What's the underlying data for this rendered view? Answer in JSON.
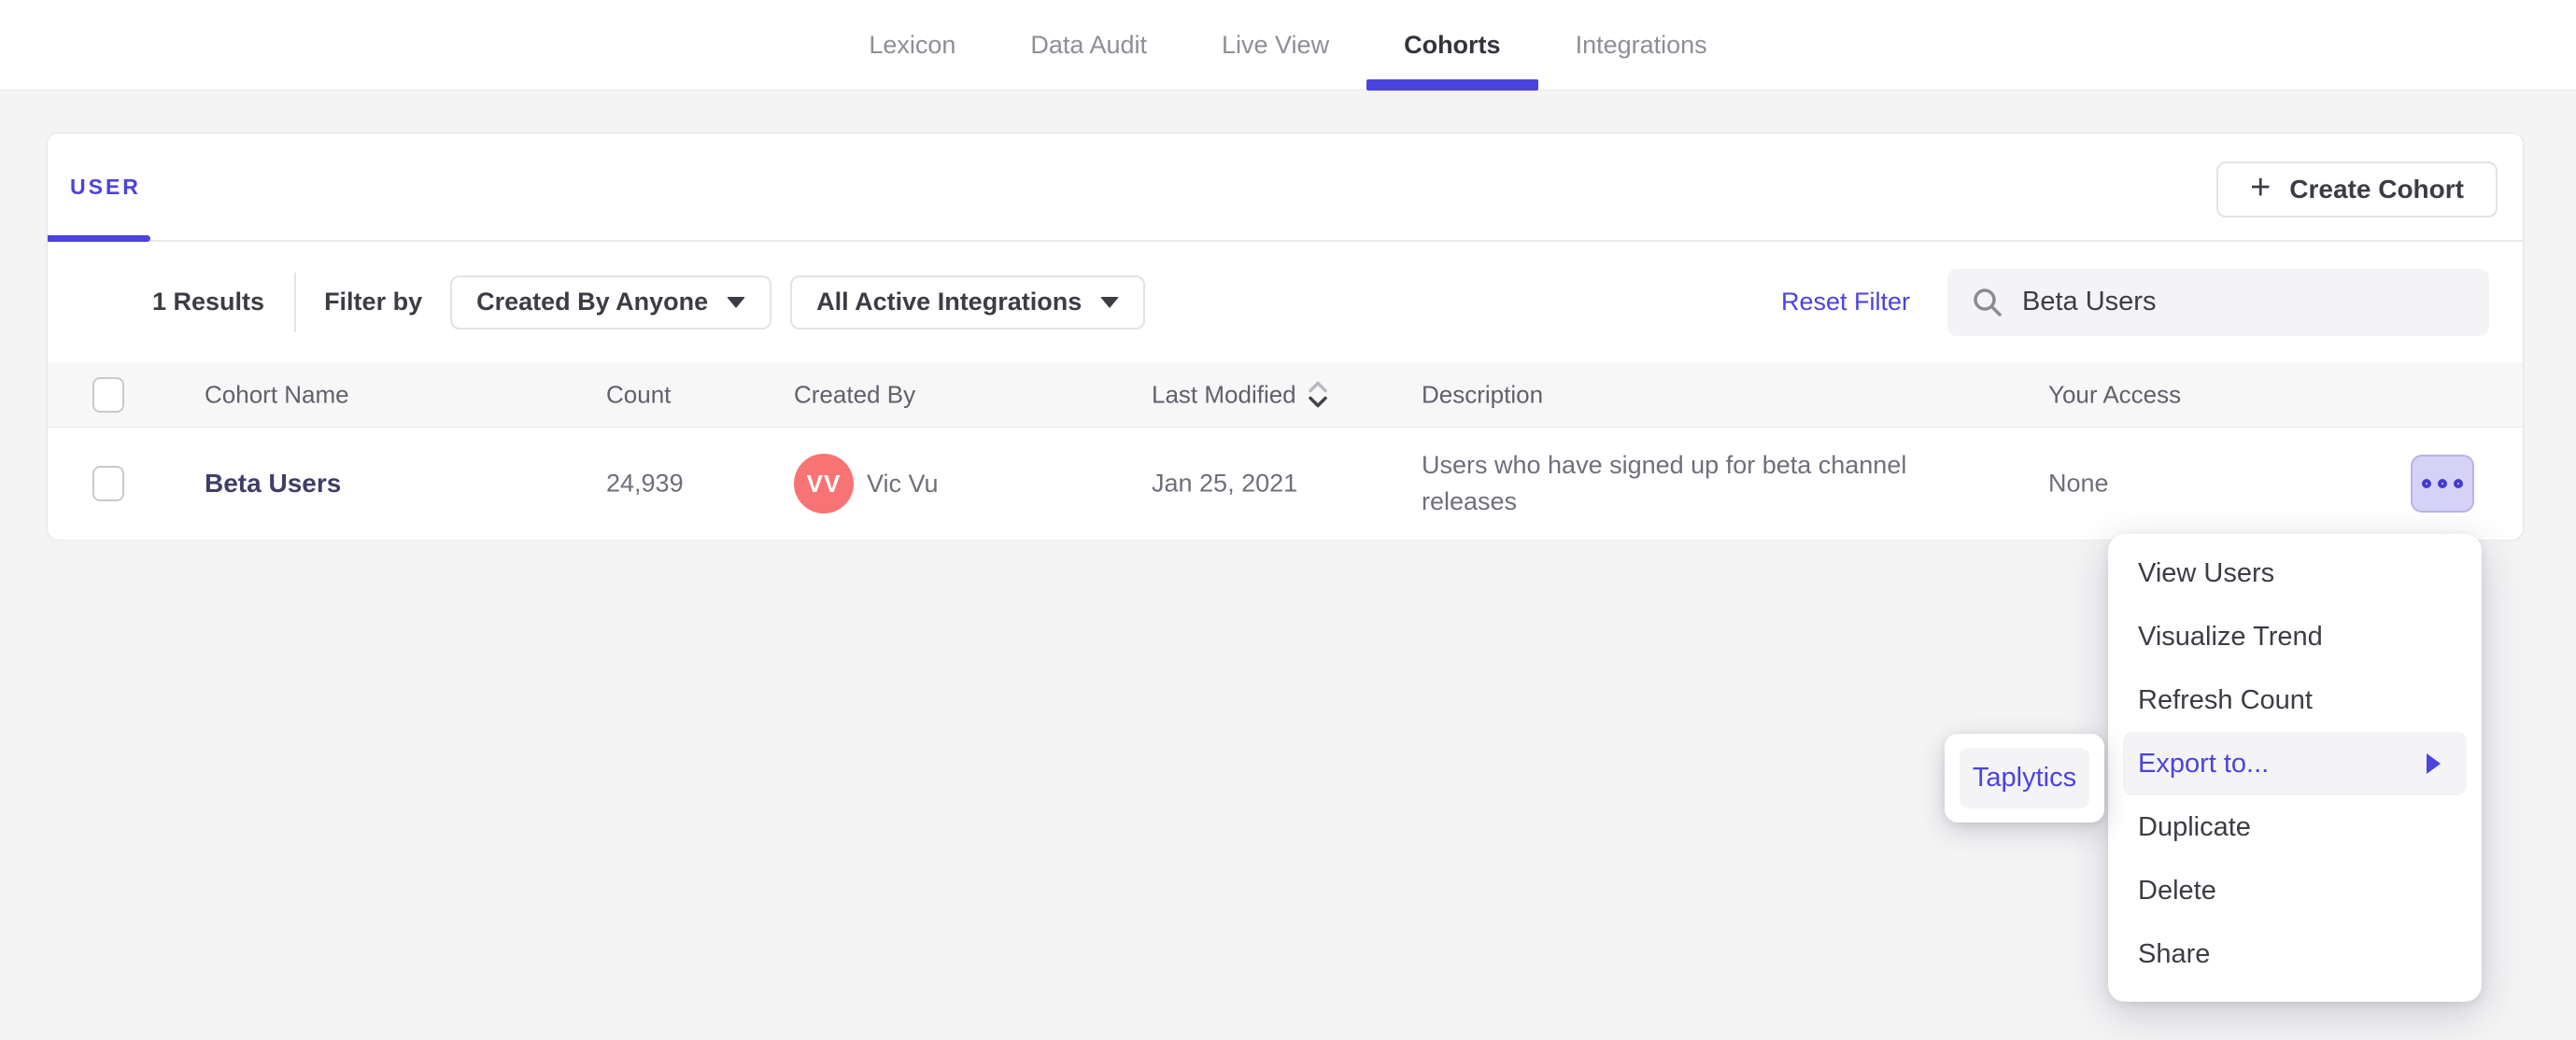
{
  "accent_color": "#4c42e0",
  "nav": {
    "tabs": [
      {
        "label": "Lexicon",
        "active": false
      },
      {
        "label": "Data Audit",
        "active": false
      },
      {
        "label": "Live View",
        "active": false
      },
      {
        "label": "Cohorts",
        "active": true
      },
      {
        "label": "Integrations",
        "active": false
      }
    ]
  },
  "cohorts_card": {
    "tab_label": "USER",
    "create_button_label": "Create Cohort",
    "create_button_plus": "+",
    "filter_bar": {
      "results_count": "1 Results",
      "filter_by_label": "Filter by",
      "dropdowns": [
        {
          "label": "Created By Anyone"
        },
        {
          "label": "All Active Integrations"
        }
      ],
      "reset_label": "Reset Filter",
      "search": {
        "value": "Beta Users",
        "icon": "search-icon"
      }
    },
    "table": {
      "columns": {
        "name": "Cohort Name",
        "count": "Count",
        "created_by": "Created By",
        "last_modified": "Last Modified",
        "description": "Description",
        "your_access": "Your Access"
      },
      "sort": {
        "column": "Last Modified",
        "direction": "desc"
      },
      "rows": [
        {
          "name": "Beta Users",
          "count": "24,939",
          "created_by": {
            "initials": "VV",
            "name": "Vic Vu",
            "avatar_color": "#f87373"
          },
          "last_modified": "Jan 25, 2021",
          "description": "Users who have signed up for beta channel releases",
          "your_access": "None"
        }
      ]
    }
  },
  "context_menu": {
    "items": [
      {
        "label": "View Users",
        "highlighted": false
      },
      {
        "label": "Visualize Trend",
        "highlighted": false
      },
      {
        "label": "Refresh Count",
        "highlighted": false
      },
      {
        "label": "Export to...",
        "highlighted": true,
        "has_submenu": true
      },
      {
        "label": "Duplicate",
        "highlighted": false
      },
      {
        "label": "Delete",
        "highlighted": false
      },
      {
        "label": "Share",
        "highlighted": false
      }
    ],
    "submenu": {
      "items": [
        {
          "label": "Taplytics",
          "highlighted": true
        }
      ]
    }
  }
}
